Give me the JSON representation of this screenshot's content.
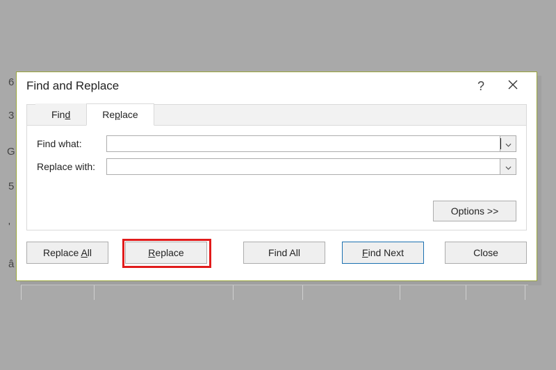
{
  "dialog": {
    "title": "Find and Replace",
    "help_symbol": "?",
    "tabs": {
      "find": {
        "prefix": "Fin",
        "ul": "d"
      },
      "replace": {
        "prefix": "Re",
        "ul": "p",
        "suffix": "lace"
      }
    },
    "fields": {
      "find_what_label": "Find what:",
      "find_what_value": "",
      "replace_with_label": "Replace with:",
      "replace_with_value": ""
    },
    "options_label": "Options >>",
    "buttons": {
      "replace_all": {
        "prefix": "Replace ",
        "ul": "A",
        "suffix": "ll"
      },
      "replace": {
        "ul": "R",
        "suffix": "eplace"
      },
      "find_all": {
        "prefix": "Find ",
        "ul": "All"
      },
      "find_next": {
        "ul": "F",
        "suffix": "ind Next"
      },
      "close": {
        "label": "Close"
      }
    }
  },
  "bg_cells": {
    "c1": "6",
    "c2": "3",
    "c3": "G",
    "c4": "5",
    "c5": "'",
    "c6": "â"
  }
}
